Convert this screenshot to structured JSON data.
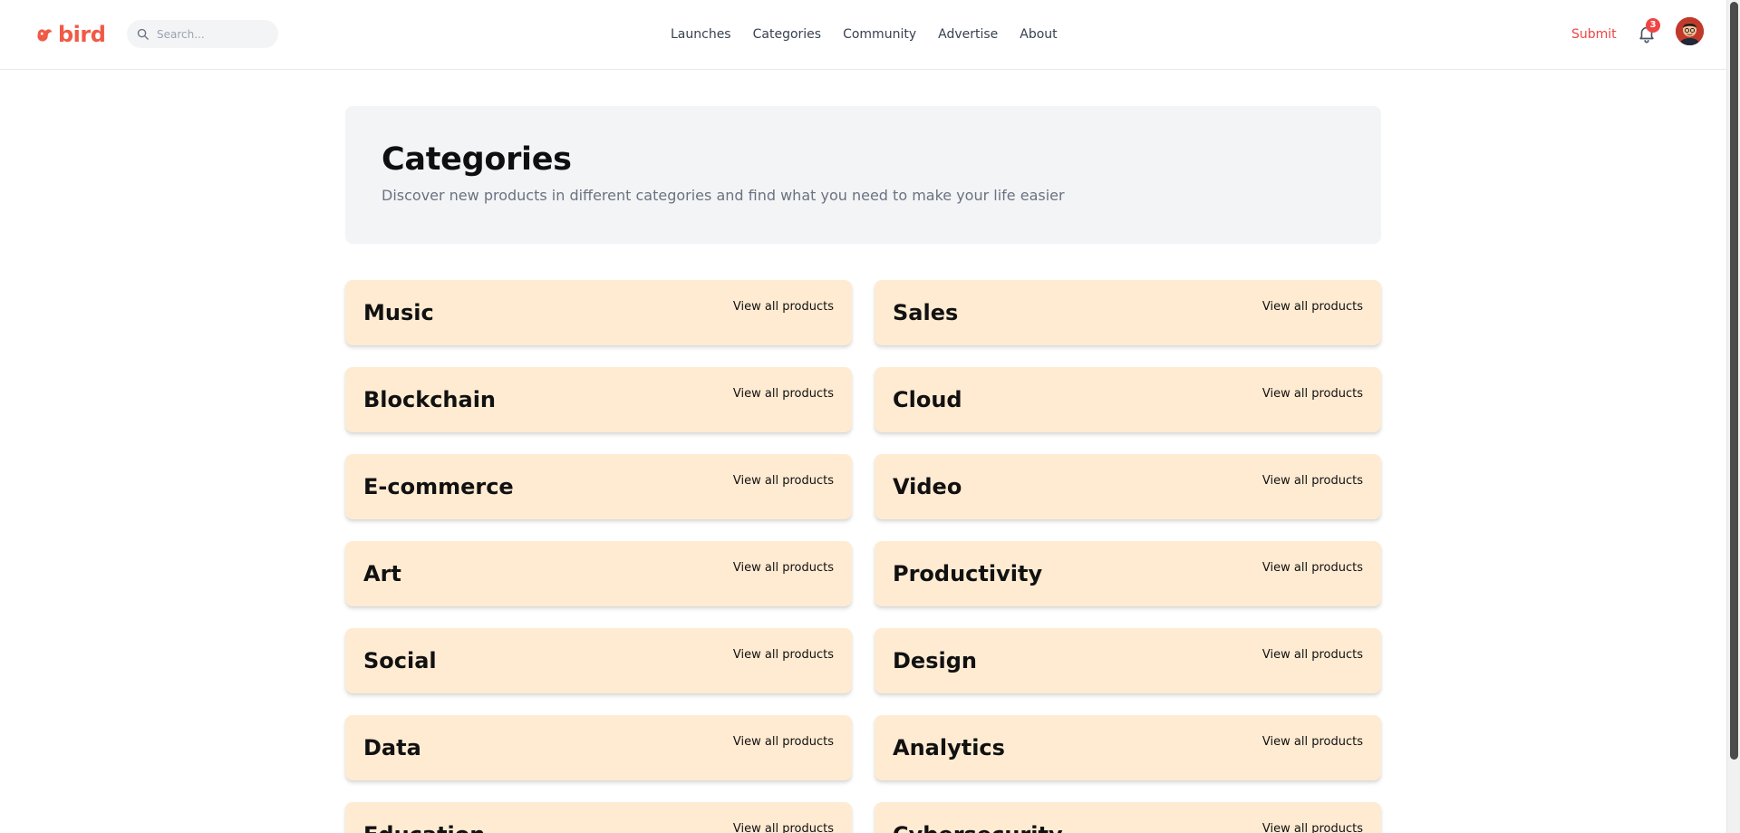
{
  "header": {
    "logo_text": "bird",
    "search_placeholder": "Search...",
    "nav": [
      "Launches",
      "Categories",
      "Community",
      "Advertise",
      "About"
    ],
    "submit_label": "Submit",
    "notification_count": "3",
    "brand_color": "#ef4444"
  },
  "hero": {
    "title": "Categories",
    "subtitle": "Discover new products in different categories and find what you need to make your life easier"
  },
  "categories": [
    {
      "name": "Music",
      "link": "View all products"
    },
    {
      "name": "Sales",
      "link": "View all products"
    },
    {
      "name": "Blockchain",
      "link": "View all products"
    },
    {
      "name": "Cloud",
      "link": "View all products"
    },
    {
      "name": "E-commerce",
      "link": "View all products"
    },
    {
      "name": "Video",
      "link": "View all products"
    },
    {
      "name": "Art",
      "link": "View all products"
    },
    {
      "name": "Productivity",
      "link": "View all products"
    },
    {
      "name": "Social",
      "link": "View all products"
    },
    {
      "name": "Design",
      "link": "View all products"
    },
    {
      "name": "Data",
      "link": "View all products"
    },
    {
      "name": "Analytics",
      "link": "View all products"
    },
    {
      "name": "Education",
      "link": "View all products"
    },
    {
      "name": "Cybersecurity",
      "link": "View all products"
    }
  ],
  "colors": {
    "card_bg": "#ffebd2",
    "hero_bg": "#f3f4f6",
    "accent": "#ef4444"
  }
}
